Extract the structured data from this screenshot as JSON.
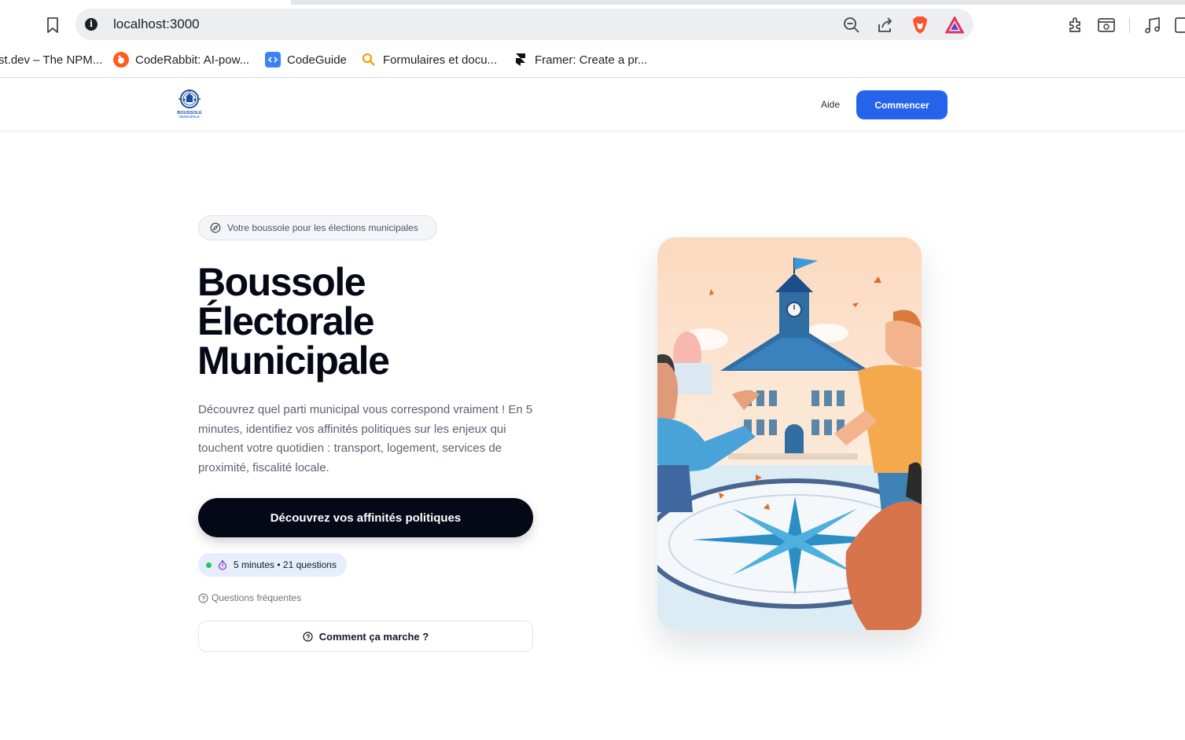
{
  "browser": {
    "url": "localhost:3000",
    "bookmarks": [
      {
        "label": "st.dev – The NPM...",
        "icon": "npm-icon"
      },
      {
        "label": "CodeRabbit: AI-pow...",
        "icon": "coderabbit-icon"
      },
      {
        "label": "CodeGuide",
        "icon": "codeguide-icon"
      },
      {
        "label": "Formulaires et docu...",
        "icon": "search-favicon-icon"
      },
      {
        "label": "Framer: Create a pr...",
        "icon": "framer-icon"
      }
    ]
  },
  "header": {
    "logo_text_top": "BOUSSOLE",
    "logo_text_bottom": "MUNICIPALE",
    "help_label": "Aide",
    "start_label": "Commencer"
  },
  "hero": {
    "badge": "Votre boussole pour les élections municipales",
    "title_lines": [
      "Boussole",
      "Électorale",
      "Municipale"
    ],
    "description": "Découvrez quel parti municipal vous correspond vraiment ! En 5 minutes, identifiez vos affinités politiques sur les enjeux qui touchent votre quotidien : transport, logement, services de proximité, fiscalité locale.",
    "cta_label": "Découvrez vos affinités politiques",
    "duration_label": "5 minutes • 21 questions",
    "faq_label": "Questions fréquentes",
    "how_label": "Comment ça marche ?"
  },
  "colors": {
    "primary_blue": "#2563eb",
    "dark": "#050816",
    "status_green": "#22c55e"
  }
}
